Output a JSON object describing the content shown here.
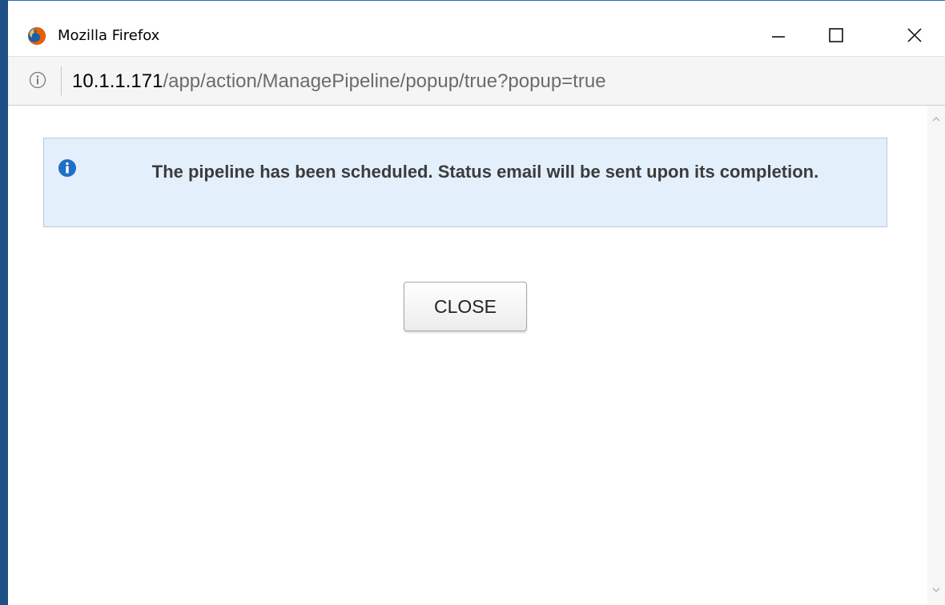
{
  "window": {
    "title": "Mozilla Firefox",
    "controls": {
      "minimize_icon": "minimize-icon",
      "maximize_icon": "maximize-icon",
      "close_icon": "close-icon"
    }
  },
  "urlbar": {
    "host": "10.1.1.171",
    "path": "/app/action/ManagePipeline/popup/true?popup=true",
    "info_icon": "info-icon"
  },
  "alert": {
    "icon": "info-circle-icon",
    "message": "The pipeline has been scheduled. Status email will be sent upon its completion."
  },
  "actions": {
    "close_label": "CLOSE"
  },
  "colors": {
    "alert_background": "#e4effc",
    "alert_icon": "#1f6fc5",
    "window_border": "#1e4f86"
  }
}
